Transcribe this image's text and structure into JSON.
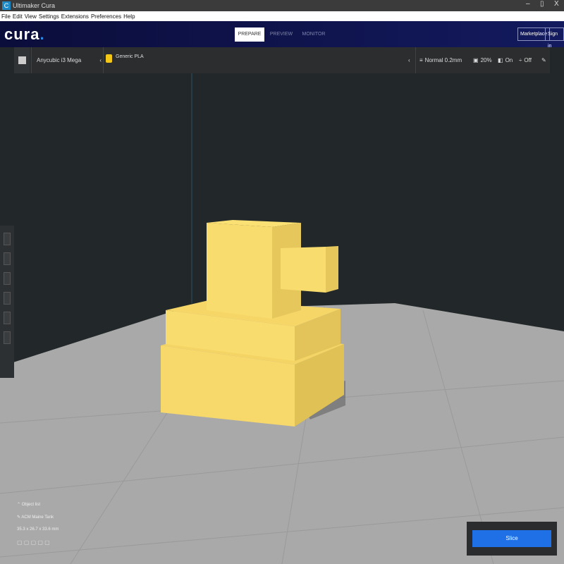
{
  "window": {
    "title": "Ultimaker Cura",
    "minimize": "–",
    "maximize": "▯",
    "close": "X"
  },
  "menu": [
    "File",
    "Edit",
    "View",
    "Settings",
    "Extensions",
    "Preferences",
    "Help"
  ],
  "header": {
    "brand": "cura",
    "stages": {
      "prepare": "PREPARE",
      "preview": "PREVIEW",
      "monitor": "MONITOR"
    },
    "marketplace": "Marketplace",
    "signin": "Sign in"
  },
  "toolbar": {
    "printer": "Anycubic i3 Mega",
    "material": "Generic PLA",
    "profile": "Normal 0.2mm",
    "infill": "20%",
    "support": "On",
    "adhesion": "Off"
  },
  "object": {
    "list_label": "Object list",
    "name": "ACM Maine Tank",
    "dimensions": "35.3 x 26.7 x 33.6 mm"
  },
  "slice": {
    "label": "Slice"
  },
  "colors": {
    "model": "#f7d86a",
    "accent": "#1f6fe6"
  }
}
